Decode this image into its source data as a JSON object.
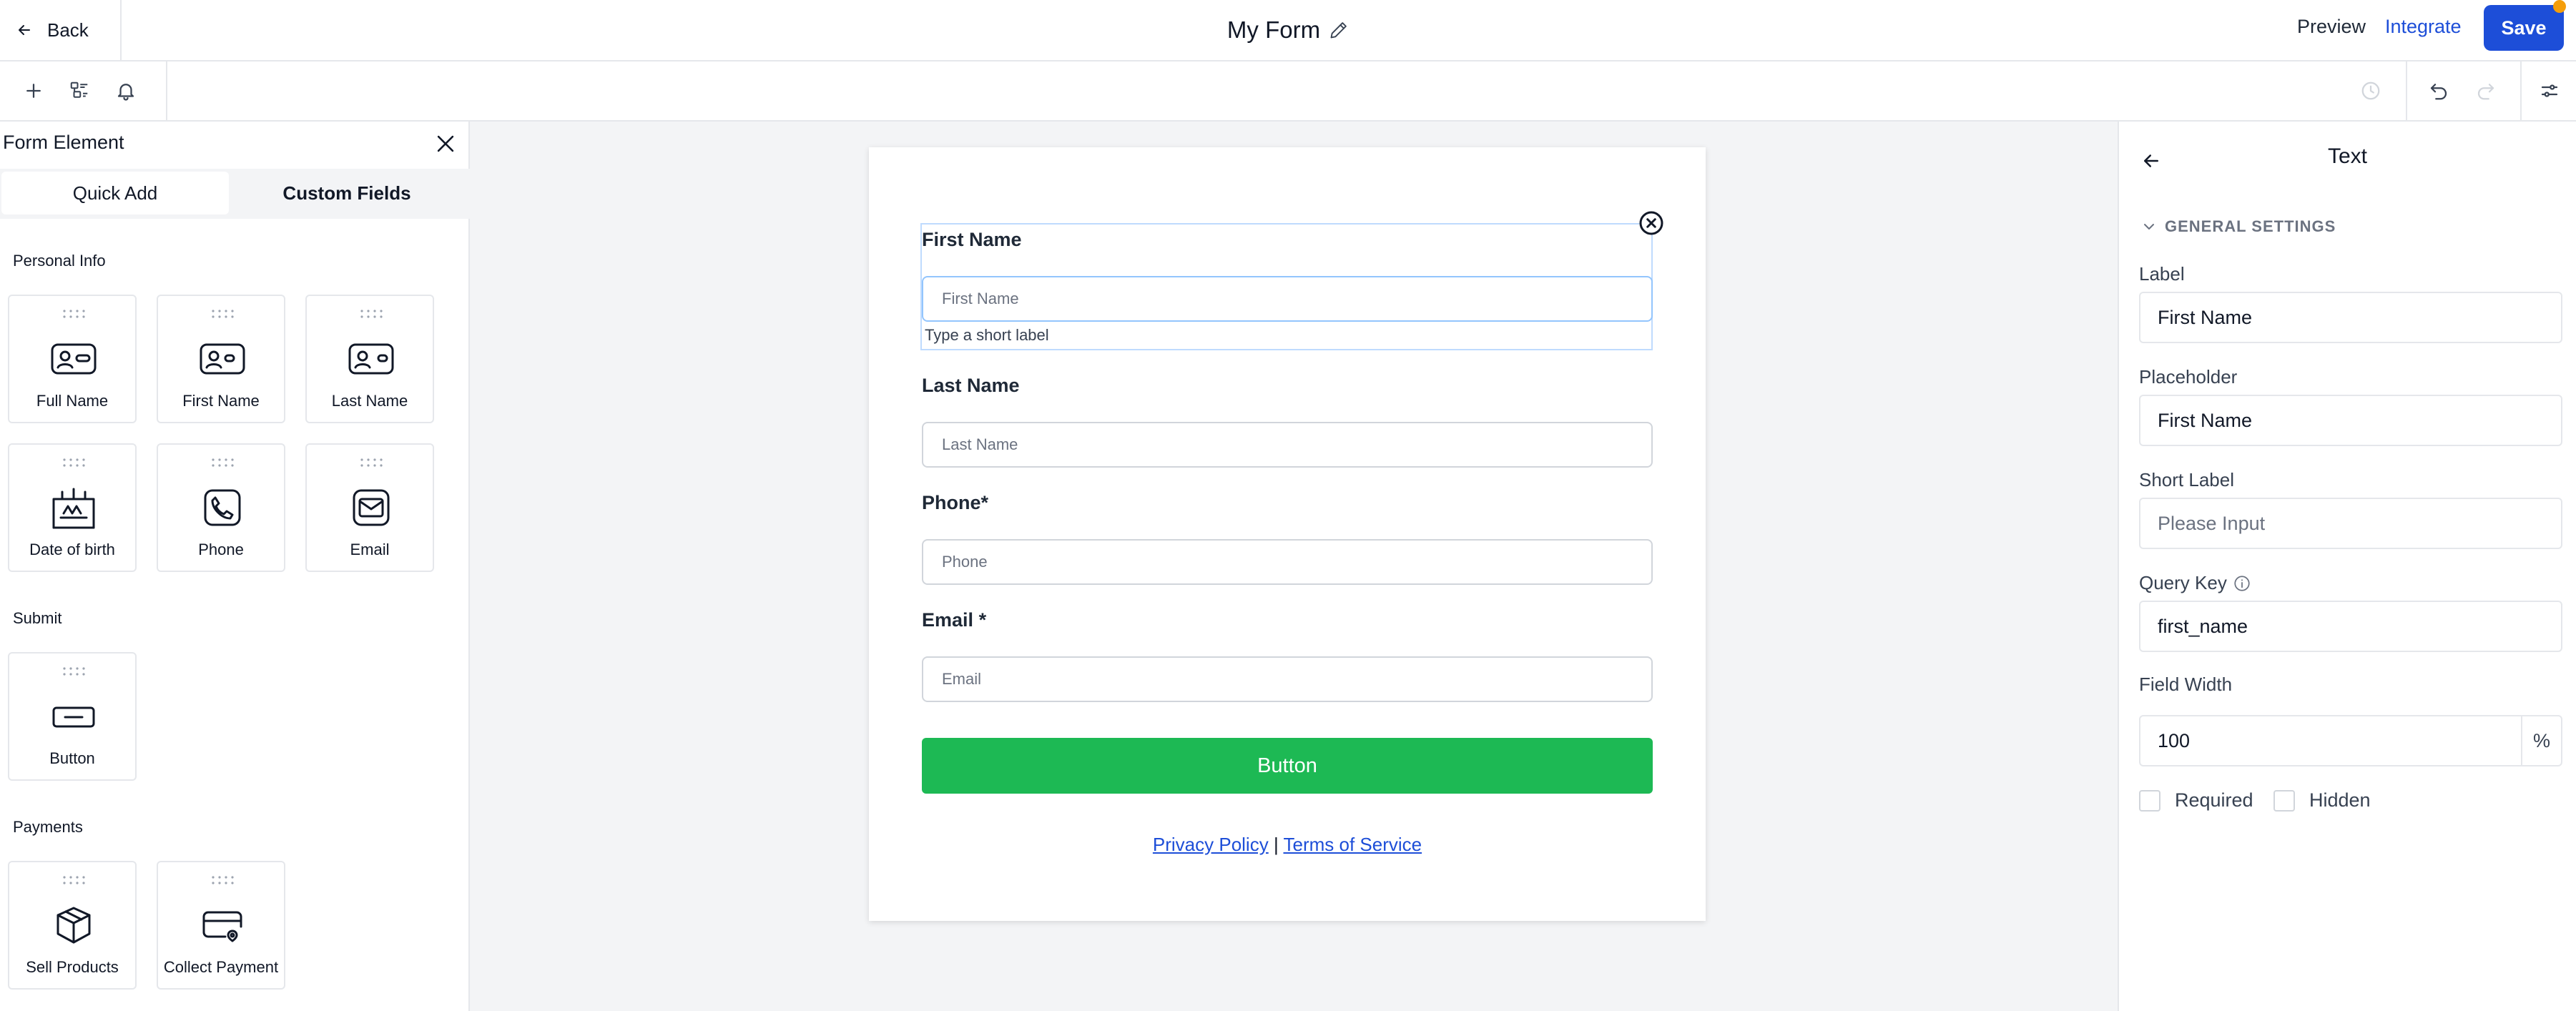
{
  "topbar": {
    "back_label": "Back",
    "form_title": "My Form",
    "preview_label": "Preview",
    "integrate_label": "Integrate",
    "save_label": "Save"
  },
  "left_panel": {
    "title": "Form Element",
    "tabs": [
      "Quick Add",
      "Custom Fields"
    ],
    "sections": {
      "personal_info": "Personal Info",
      "submit": "Submit",
      "payments": "Payments"
    },
    "tiles": {
      "full_name": "Full Name",
      "first_name": "First Name",
      "last_name": "Last Name",
      "date_of_birth": "Date of birth",
      "phone": "Phone",
      "email": "Email",
      "button": "Button",
      "sell_products": "Sell Products",
      "collect_payment": "Collect Payment"
    }
  },
  "form": {
    "first_name": {
      "label": "First Name",
      "placeholder": "First Name",
      "short_label": "Type a short label"
    },
    "last_name": {
      "label": "Last Name",
      "placeholder": "Last Name"
    },
    "phone": {
      "label": "Phone",
      "required_mark": "*",
      "placeholder": "Phone"
    },
    "email": {
      "label": "Email",
      "required_mark": "*",
      "placeholder": "Email"
    },
    "button_label": "Button",
    "privacy_link": "Privacy Policy",
    "separator": "|",
    "terms_link": "Terms of Service"
  },
  "right_panel": {
    "title": "Text",
    "section": "GENERAL SETTINGS",
    "label_label": "Label",
    "label_value": "First Name",
    "placeholder_label": "Placeholder",
    "placeholder_value": "First Name",
    "short_label_label": "Short Label",
    "short_label_placeholder": "Please Input",
    "query_key_label": "Query Key",
    "query_key_value": "first_name",
    "field_width_label": "Field Width",
    "field_width_value": "100",
    "field_width_unit": "%",
    "required_label": "Required",
    "hidden_label": "Hidden"
  },
  "colors": {
    "accent": "#1d4ed8",
    "submit_button": "#1db954",
    "save_indicator": "#f59e0b"
  }
}
